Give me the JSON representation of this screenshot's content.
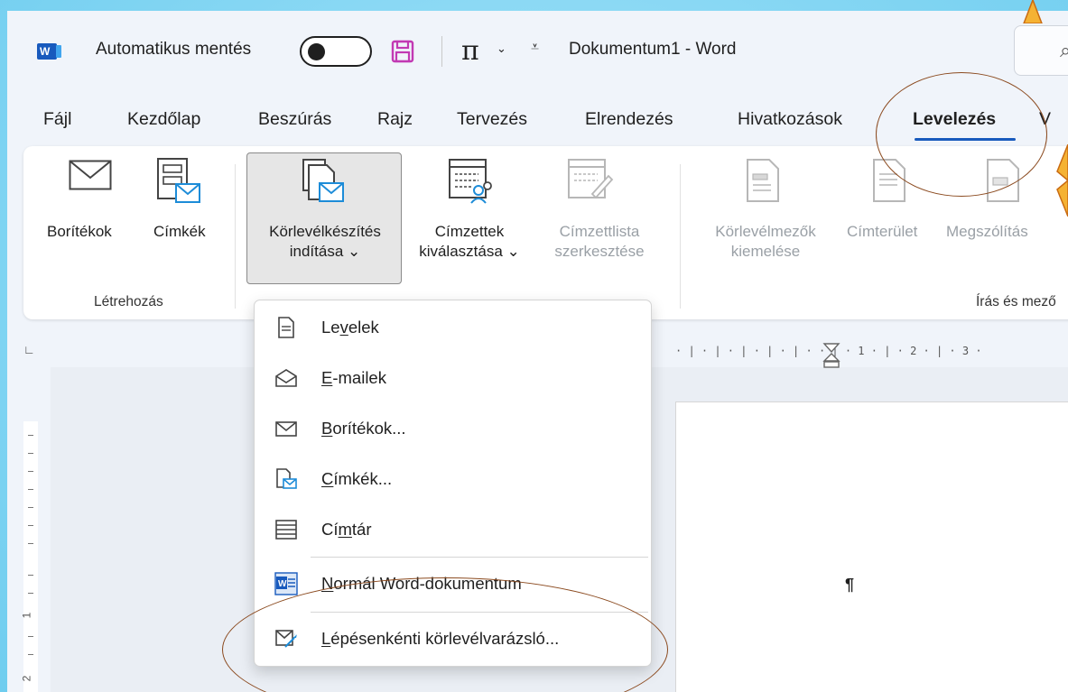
{
  "titlebar": {
    "autosave_label": "Automatikus mentés",
    "qat_more": "≥",
    "doc_title": "Dokumentum1  -  Word"
  },
  "tabs": [
    "Fájl",
    "Kezdőlap",
    "Beszúrás",
    "Rajz",
    "Tervezés",
    "Elrendezés",
    "Hivatkozások",
    "Levelezés",
    "V"
  ],
  "active_tab": "Levelezés",
  "ribbon": {
    "envelopes": "Borítékok",
    "labels": "Címkék",
    "start_merge_1": "Körlevélkészítés",
    "start_merge_2": "indítása",
    "select_recipients_1": "Címzettek",
    "select_recipients_2": "kiválasztása",
    "edit_list_1": "Címzettlista",
    "edit_list_2": "szerkesztése",
    "highlight_fields_1": "Körlevélmezők",
    "highlight_fields_2": "kiemelése",
    "address_block": "Címterület",
    "greeting_line": "Megszólítás",
    "group_create": "Létrehozás",
    "group_write": "Írás és mező"
  },
  "ruler": {
    "h_text": "· | · | · | · | · | ·    · | · 1 · | · 2 · | · 3 ·",
    "v_numbers": [
      "1",
      "2"
    ]
  },
  "document": {
    "pilcrow": "¶"
  },
  "dropdown": {
    "letters": {
      "pre": "Le",
      "u": "v",
      "post": "elek"
    },
    "emails": {
      "pre": "",
      "u": "E",
      "post": "-mailek"
    },
    "envelopes": {
      "pre": "",
      "u": "B",
      "post": "orítékok..."
    },
    "labels": {
      "pre": "",
      "u": "C",
      "post": "ímkék..."
    },
    "directory": {
      "pre": "Cí",
      "u": "m",
      "post": "tár"
    },
    "normal_doc": {
      "pre": "",
      "u": "N",
      "post": "ormál Word-dokumentum"
    },
    "wizard": {
      "pre": "",
      "u": "L",
      "post": "épésenkénti körlevélvarázsló..."
    }
  },
  "colors": {
    "accent": "#185abd",
    "annotation": "#8b4a1f",
    "background": "#7fd3f1"
  }
}
